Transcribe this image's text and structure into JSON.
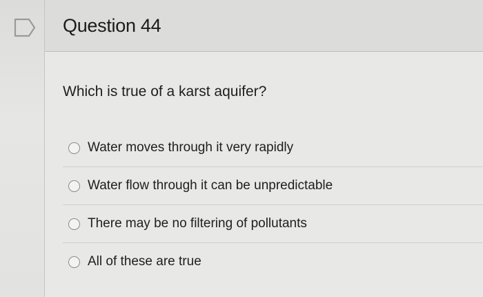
{
  "question": {
    "title": "Question 44",
    "prompt": "Which is true of a karst aquifer?",
    "flag_icon": "bookmark-flag-icon",
    "options": [
      {
        "label": "Water moves through it very rapidly"
      },
      {
        "label": "Water flow through it can be unpredictable"
      },
      {
        "label": "There may be no filtering of pollutants"
      },
      {
        "label": "All of these are true"
      }
    ]
  },
  "colors": {
    "header_bg": "#dcdcda",
    "body_bg": "#e8e8e6",
    "radio_border": "#8a8a8a"
  }
}
